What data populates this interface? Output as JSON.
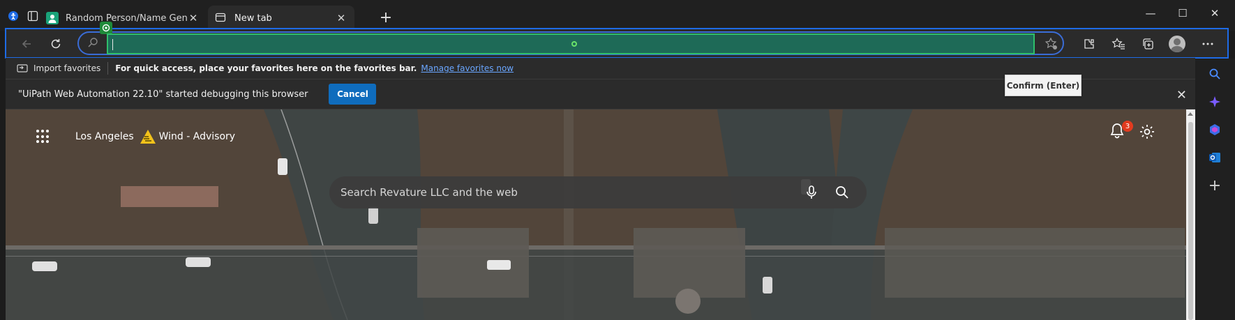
{
  "tabs": [
    {
      "title": "Random Person/Name Generator",
      "favicon_color": "#1aa37a"
    },
    {
      "title": "New tab"
    }
  ],
  "tab_close_glyph": "✕",
  "new_tab_glyph": "+",
  "window_controls": {
    "minimize": "—",
    "maximize": "☐",
    "close": "✕"
  },
  "address_bar": {
    "value": "",
    "placeholder": ""
  },
  "favorites_bar": {
    "import_label": "Import favorites",
    "quick_access_text": "For quick access, place your favorites here on the favorites bar.",
    "manage_link": "Manage favorites now"
  },
  "infobar": {
    "message": "\"UiPath Web Automation 22.10\" started debugging this browser",
    "cancel_label": "Cancel",
    "close_glyph": "✕"
  },
  "tooltip": {
    "text": "Confirm (Enter)"
  },
  "new_tab_page": {
    "location": "Los Angeles",
    "weather_alert": "Wind - Advisory",
    "notification_count": "3",
    "search_placeholder": "Search Revature LLC and the web"
  },
  "sidebar": {
    "add_glyph": "+"
  },
  "colors": {
    "accent": "#0f6cbd",
    "focus_outline": "#1e6be6",
    "highlight_fill": "#1e6a57",
    "highlight_border": "#2fbf6b",
    "badge": "#e23b1f"
  }
}
